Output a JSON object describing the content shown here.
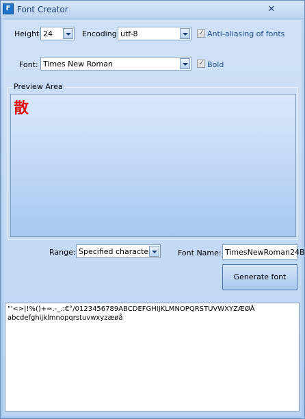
{
  "window": {
    "title": "Font Creator",
    "close_symbol": "✕",
    "icon_letter": "F"
  },
  "height": {
    "label": "Height:",
    "value": "24"
  },
  "encoding": {
    "label": "Encoding:",
    "value": "utf-8"
  },
  "antialias": {
    "label": "Anti-aliasing of fonts",
    "checked": true
  },
  "font": {
    "label": "Font:",
    "value": "Times New Roman"
  },
  "bold": {
    "label": "Bold",
    "checked": true
  },
  "preview": {
    "title": "Preview Area",
    "glyph": "散"
  },
  "range": {
    "label": "Range:",
    "value": "Specified character"
  },
  "font_name": {
    "label": "Font Name:",
    "value": "TimesNewRoman24B"
  },
  "generate_button": {
    "label": "Generate font"
  },
  "characters": {
    "line1": "\"'<>|!%()+=.-_.:€°/0123456789ABCDEFGHIJKLMNOPQRSTUVWXYZÆØÅ",
    "line2": "abcdefghijklmnopqrstuvwxyzæøå"
  },
  "colors": {
    "accent": "#1e73c8",
    "preview_glyph": "#e01010"
  }
}
